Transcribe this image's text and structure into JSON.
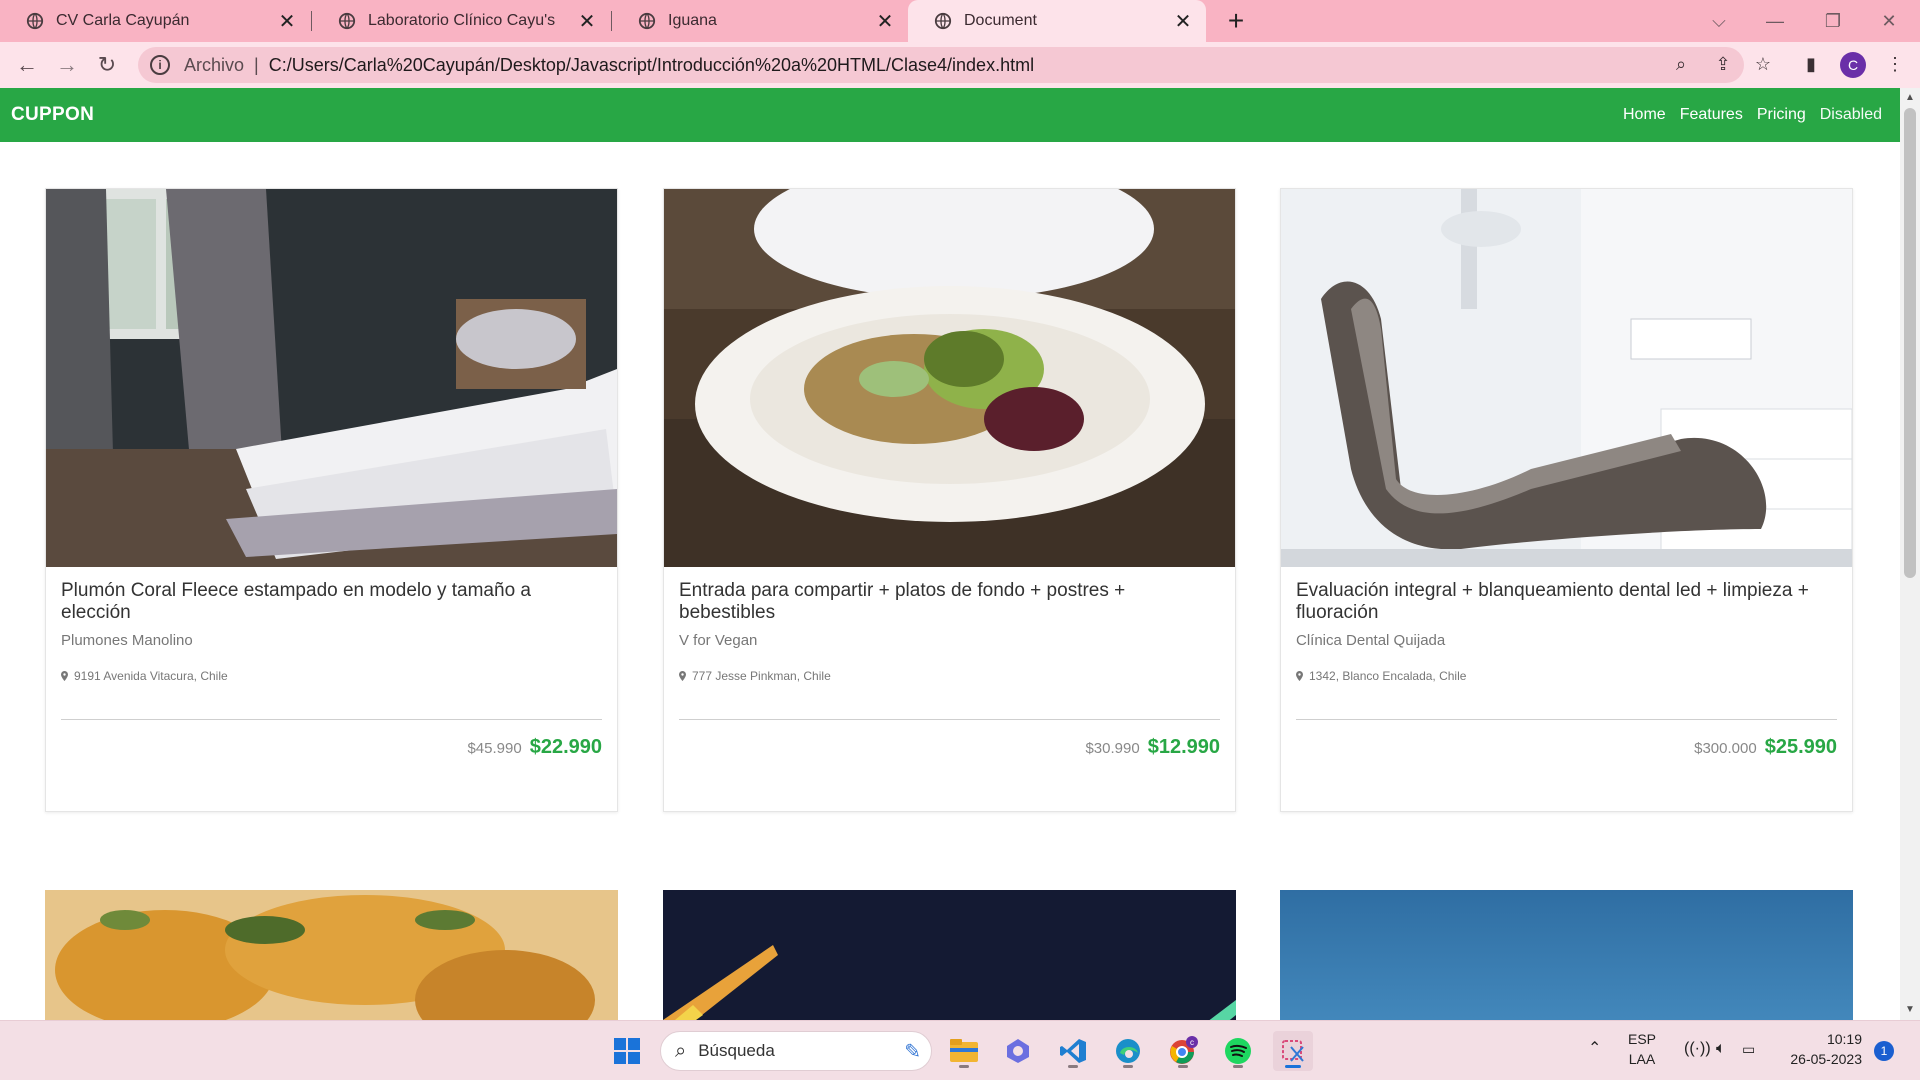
{
  "browser": {
    "tabs": [
      {
        "title": "CV Carla Cayupán",
        "active": false
      },
      {
        "title": "Laboratorio Clínico Cayu's",
        "active": false
      },
      {
        "title": "Iguana",
        "active": false
      },
      {
        "title": "Document",
        "active": true
      }
    ],
    "address": {
      "origin_label": "Archivo",
      "url": "C:/Users/Carla%20Cayupán/Desktop/Javascript/Introducción%20a%20HTML/Clase4/index.html"
    },
    "profile_initial": "C",
    "accent_color": "#f9b3c3"
  },
  "page": {
    "brand": "CUPPON",
    "nav": [
      "Home",
      "Features",
      "Pricing",
      "Disabled"
    ],
    "nav_color": "#28a745",
    "cards": [
      {
        "title": "Plumón Coral Fleece estampado en modelo y tamaño a elección",
        "company": "Plumones Manolino",
        "address": "9191 Avenida Vitacura, Chile",
        "old_price": "$45.990",
        "new_price": "$22.990",
        "image": "bedroom-bed-photo"
      },
      {
        "title": "Entrada para compartir + platos de fondo + postres + bebestibles",
        "company": "V for Vegan",
        "address": "777 Jesse Pinkman, Chile",
        "old_price": "$30.990",
        "new_price": "$12.990",
        "image": "vegan-salad-plate-photo"
      },
      {
        "title": "Evaluación integral + blanqueamiento dental led + limpieza + fluoración",
        "company": "Clínica Dental Quijada",
        "address": "1342, Blanco Encalada, Chile",
        "old_price": "$300.000",
        "new_price": "$25.990",
        "image": "dental-chair-photo"
      }
    ],
    "second_row_images": [
      "food-closeup-photo",
      "night-sky-photo",
      "blue-sky-photo"
    ],
    "price_color": "#28a745"
  },
  "taskbar": {
    "search_placeholder": "Búsqueda",
    "language": "ESP",
    "layout": "LAA",
    "time": "10:19",
    "date": "26-05-2023",
    "notifications": "1"
  }
}
